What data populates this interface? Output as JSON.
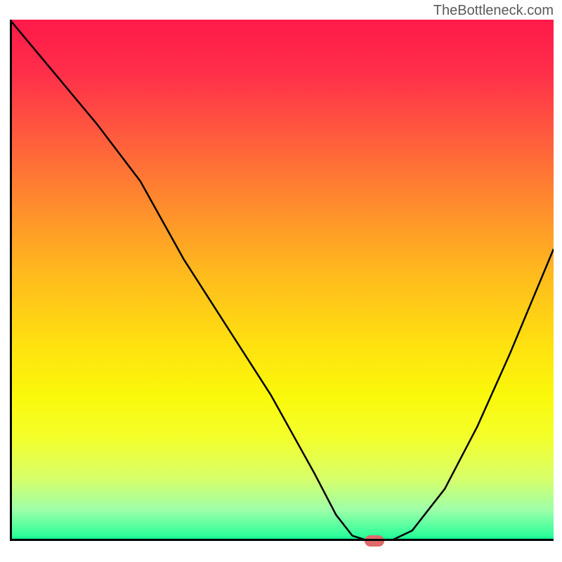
{
  "watermark": "TheBottleneck.com",
  "chart_data": {
    "type": "line",
    "title": "",
    "xlabel": "",
    "ylabel": "",
    "xlim": [
      0,
      100
    ],
    "ylim": [
      0,
      100
    ],
    "x": [
      0,
      8,
      16,
      24,
      32,
      40,
      48,
      56,
      60,
      63,
      66,
      70,
      74,
      80,
      86,
      92,
      100
    ],
    "values": [
      100,
      90,
      80,
      69,
      54,
      41,
      28,
      13,
      5,
      1,
      0,
      0,
      2,
      10,
      22,
      36,
      56
    ],
    "marker": {
      "x": 67,
      "y": 0
    },
    "gradient_stops": [
      {
        "pos": 0,
        "color": "#ff1a4a"
      },
      {
        "pos": 50,
        "color": "#ffc81e"
      },
      {
        "pos": 80,
        "color": "#f4ff2a"
      },
      {
        "pos": 100,
        "color": "#00e088"
      }
    ]
  }
}
